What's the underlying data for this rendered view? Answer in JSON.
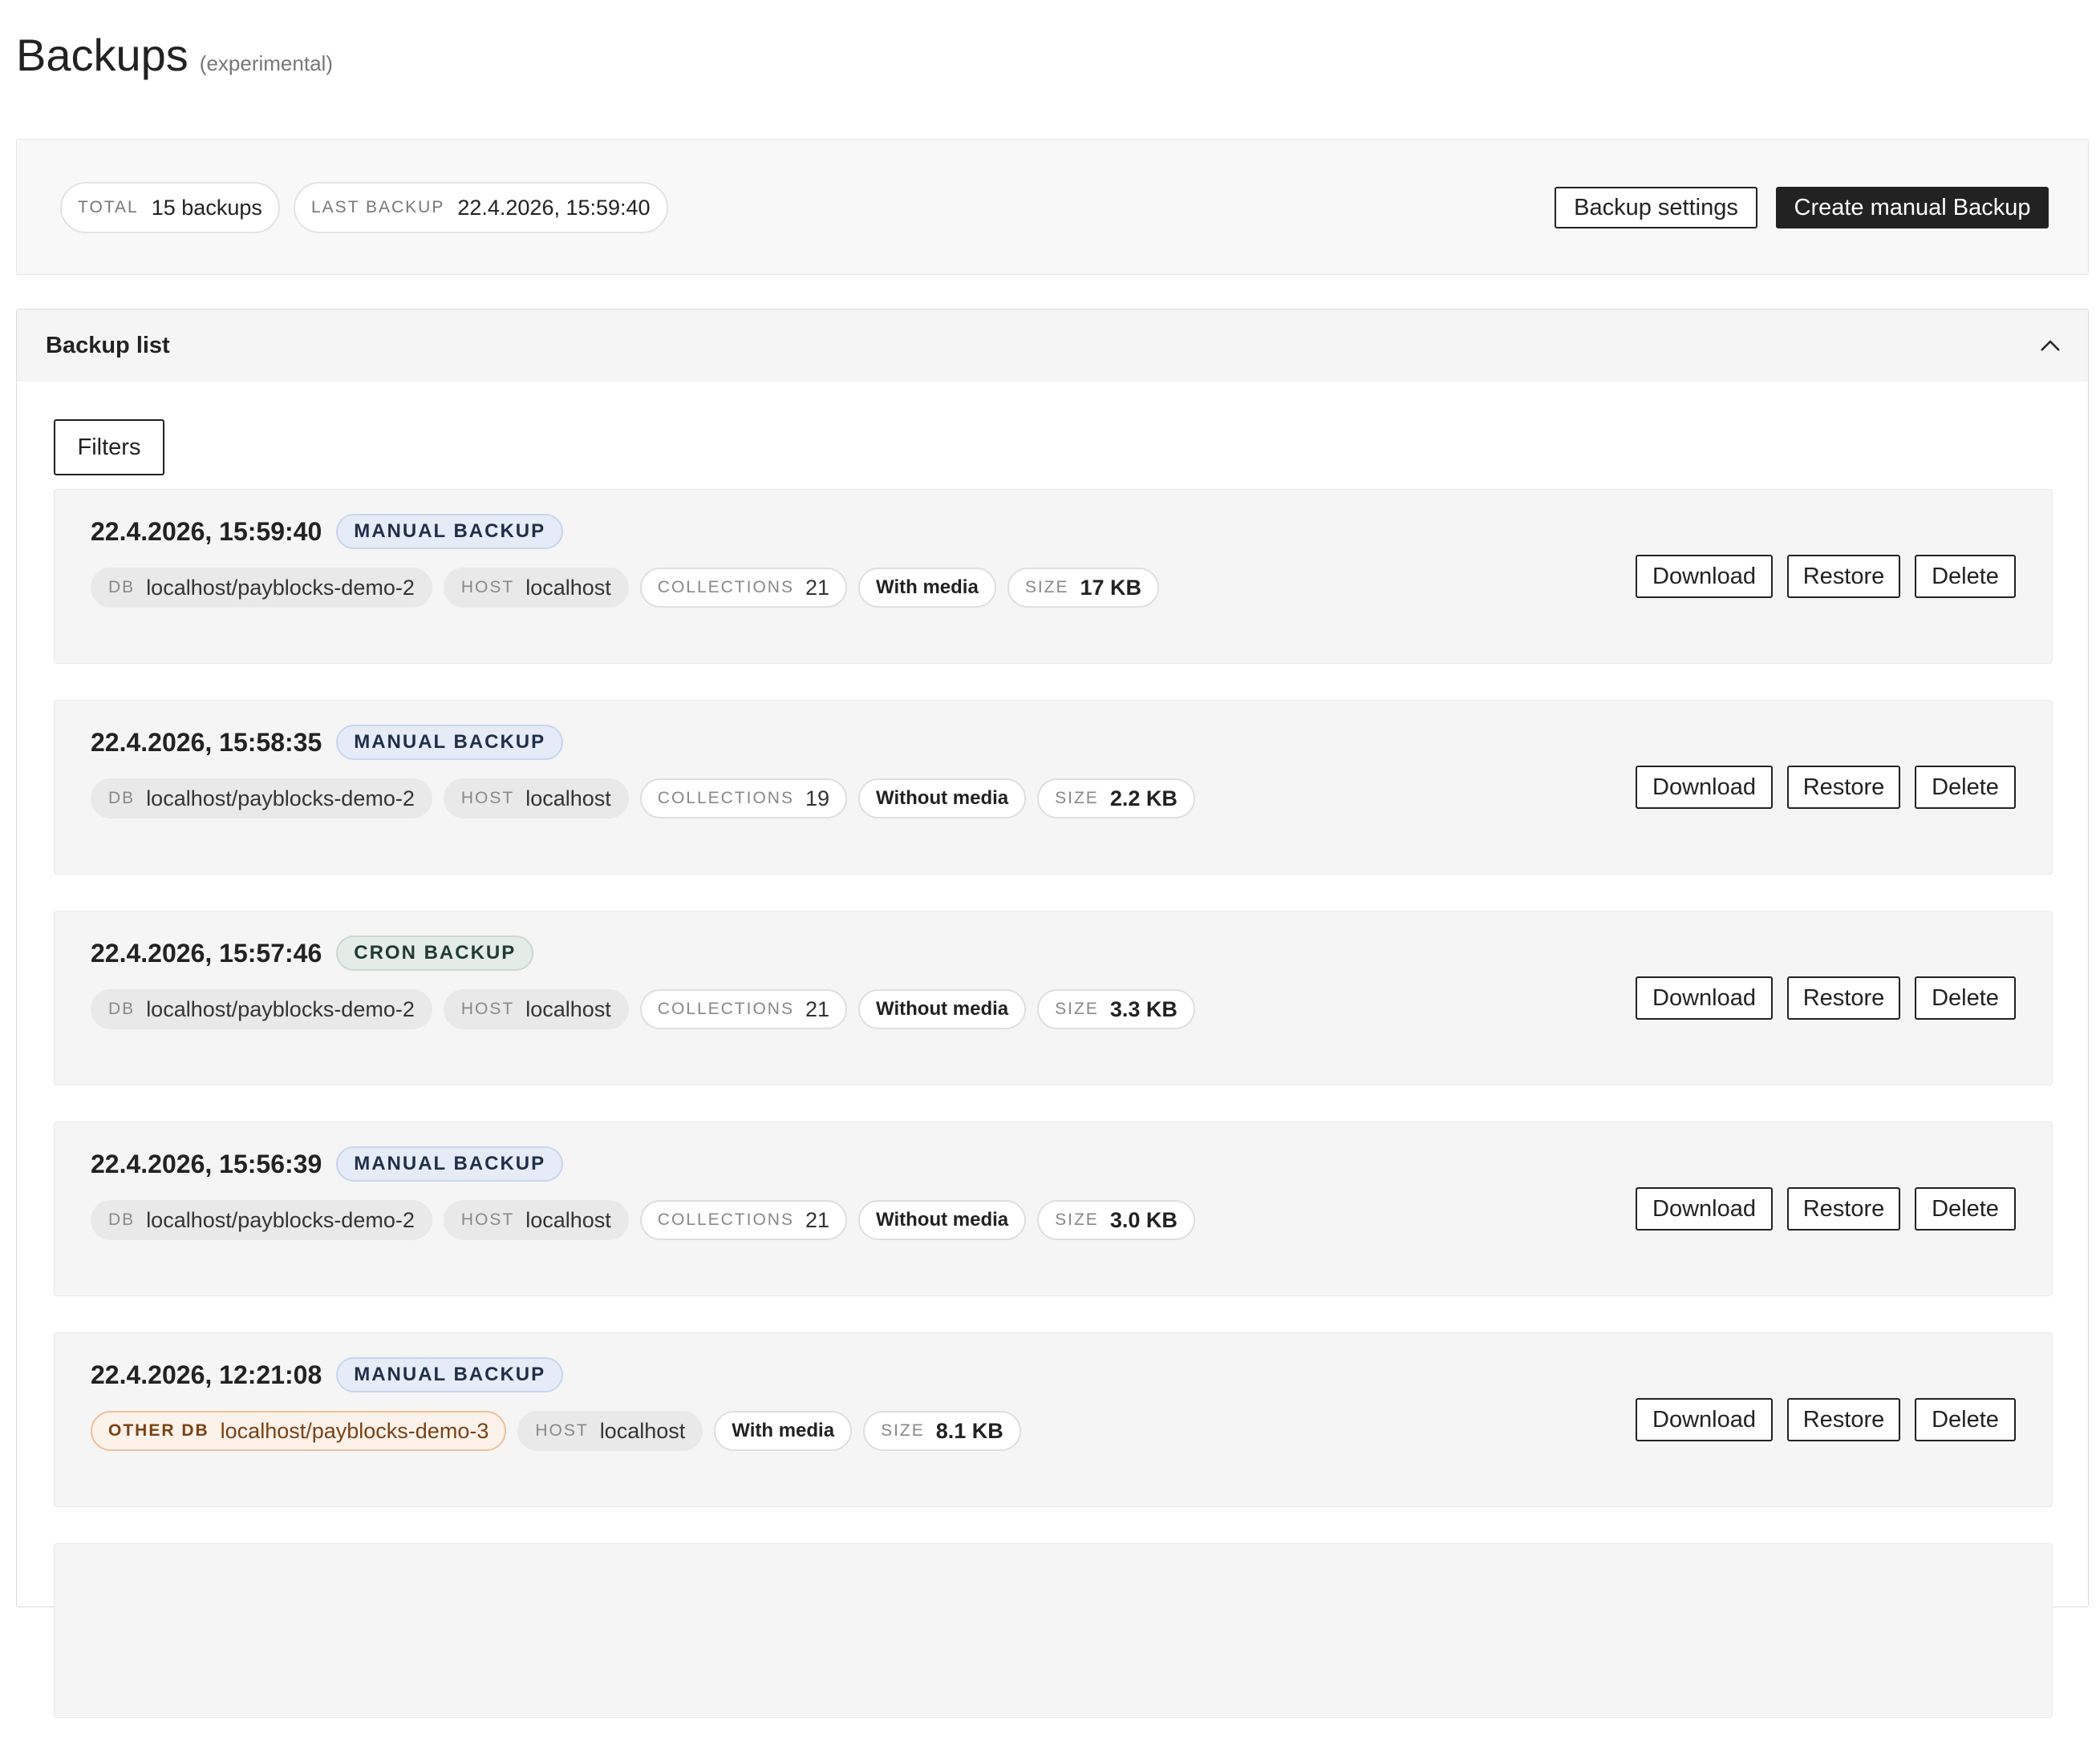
{
  "header": {
    "title": "Backups",
    "subtitle": "(experimental)"
  },
  "summary": {
    "total_label": "TOTAL",
    "total_value": "15 backups",
    "last_label": "LAST BACKUP",
    "last_value": "22.4.2026, 15:59:40",
    "settings_button": "Backup settings",
    "create_button": "Create manual Backup"
  },
  "panel": {
    "title": "Backup list",
    "collapse_icon": "chevron-up-icon",
    "filters_button": "Filters"
  },
  "actions": {
    "download": "Download",
    "restore": "Restore",
    "delete": "Delete"
  },
  "backups": [
    {
      "date": "22.4.2026, 15:59:40",
      "type": "MANUAL BACKUP",
      "db_label": "DB",
      "db": "localhost/payblocks-demo-2",
      "host_label": "HOST",
      "host": "localhost",
      "collections_label": "COLLECTIONS",
      "collections": "21",
      "media": "With media",
      "size_label": "SIZE",
      "size": "17 KB"
    },
    {
      "date": "22.4.2026, 15:58:35",
      "type": "MANUAL BACKUP",
      "db_label": "DB",
      "db": "localhost/payblocks-demo-2",
      "host_label": "HOST",
      "host": "localhost",
      "collections_label": "COLLECTIONS",
      "collections": "19",
      "media": "Without media",
      "size_label": "SIZE",
      "size": "2.2 KB"
    },
    {
      "date": "22.4.2026, 15:57:46",
      "type": "CRON BACKUP",
      "db_label": "DB",
      "db": "localhost/payblocks-demo-2",
      "host_label": "HOST",
      "host": "localhost",
      "collections_label": "COLLECTIONS",
      "collections": "21",
      "media": "Without media",
      "size_label": "SIZE",
      "size": "3.3 KB"
    },
    {
      "date": "22.4.2026, 15:56:39",
      "type": "MANUAL BACKUP",
      "db_label": "DB",
      "db": "localhost/payblocks-demo-2",
      "host_label": "HOST",
      "host": "localhost",
      "collections_label": "COLLECTIONS",
      "collections": "21",
      "media": "Without media",
      "size_label": "SIZE",
      "size": "3.0 KB"
    },
    {
      "date": "22.4.2026, 12:21:08",
      "type": "MANUAL BACKUP",
      "db_label": "OTHER DB",
      "db": "localhost/payblocks-demo-3",
      "host_label": "HOST",
      "host": "localhost",
      "media": "With media",
      "size_label": "SIZE",
      "size": "8.1 KB"
    }
  ]
}
